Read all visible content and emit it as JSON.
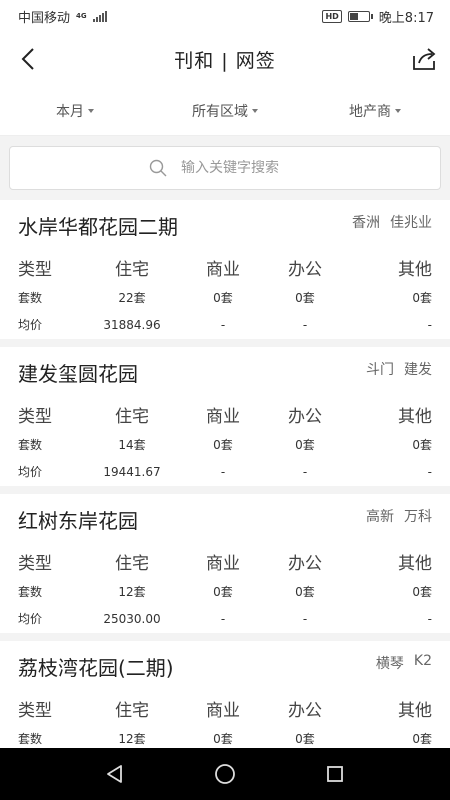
{
  "status_bar": {
    "carrier": "中国移动",
    "network": "4G",
    "hd_badge": "HD",
    "time": "晚上8:17"
  },
  "header": {
    "title": "刊和 | 网签",
    "back_icon": "chevron-left-icon",
    "share_icon": "share-icon"
  },
  "filters": [
    {
      "label": "本月"
    },
    {
      "label": "所有区域"
    },
    {
      "label": "地产商"
    }
  ],
  "search": {
    "placeholder": "输入关键字搜索"
  },
  "column_headers": [
    "类型",
    "住宅",
    "商业",
    "办公",
    "其他"
  ],
  "row_labels": {
    "count": "套数",
    "avg": "均价"
  },
  "projects": [
    {
      "name": "水岸华都花园二期",
      "district": "香洲",
      "developer": "佳兆业",
      "counts": [
        "22套",
        "0套",
        "0套",
        "0套"
      ],
      "avg_prices": [
        "31884.96",
        "-",
        "-",
        "-"
      ]
    },
    {
      "name": "建发玺圆花园",
      "district": "斗门",
      "developer": "建发",
      "counts": [
        "14套",
        "0套",
        "0套",
        "0套"
      ],
      "avg_prices": [
        "19441.67",
        "-",
        "-",
        "-"
      ]
    },
    {
      "name": "红树东岸花园",
      "district": "高新",
      "developer": "万科",
      "counts": [
        "12套",
        "0套",
        "0套",
        "0套"
      ],
      "avg_prices": [
        "25030.00",
        "-",
        "-",
        "-"
      ]
    },
    {
      "name": "荔枝湾花园(二期)",
      "district": "横琴",
      "developer": "K2",
      "counts": [
        "12套",
        "0套",
        "0套",
        "0套"
      ],
      "avg_prices": []
    }
  ],
  "system_nav": {
    "back_icon": "triangle-back-icon",
    "home_icon": "circle-home-icon",
    "recents_icon": "square-recents-icon"
  }
}
